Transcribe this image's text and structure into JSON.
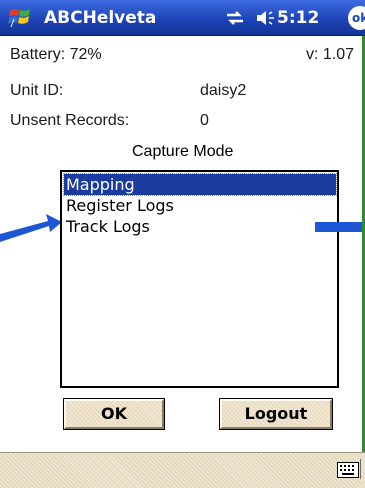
{
  "titlebar": {
    "app_title": "ABCHelveta",
    "time": "5:12",
    "ok_label": "ok"
  },
  "info": {
    "battery": "Battery: 72%",
    "version": "v: 1.07",
    "unit_id_label": "Unit ID:",
    "unit_id_value": "daisy2",
    "unsent_label": "Unsent Records:",
    "unsent_value": "0"
  },
  "capture_mode": {
    "label": "Capture Mode",
    "items": [
      {
        "label": "Mapping",
        "selected": true
      },
      {
        "label": "Register Logs",
        "selected": false
      },
      {
        "label": "Track Logs",
        "selected": false
      }
    ]
  },
  "buttons": {
    "ok_label": "OK",
    "logout_label": "Logout"
  },
  "colors": {
    "titlebar": "#1d44b8",
    "selection": "#1b3c9e",
    "annotation_arrow": "#1e57d6"
  },
  "icons": {
    "start": "windows-flag-icon",
    "connectivity": "connectivity-icon",
    "volume": "speaker-icon",
    "keyboard": "keyboard-icon"
  }
}
